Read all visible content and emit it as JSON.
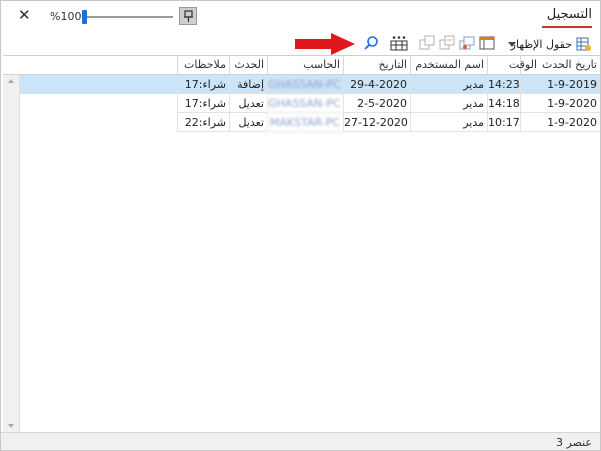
{
  "window": {
    "title": "التسجيل",
    "close_glyph": "✕"
  },
  "zoom": {
    "label": "%100",
    "level_percent": 100
  },
  "toolbar": {
    "fields_label": "حقول الإظهار",
    "icons": [
      "fields-icon",
      "dropdown-icon",
      "layout-icon",
      "export-icon",
      "collapse-icon",
      "expand-icon",
      "columns-icon",
      "search-icon",
      "pin-icon"
    ],
    "accent_color": "#e0181c"
  },
  "grid": {
    "columns": [
      "تاريخ الحدث",
      "الوقت",
      "اسم المستخدم",
      "التاريخ",
      "الحاسب",
      "الحدث",
      "ملاحظات"
    ],
    "rows": [
      {
        "event_date": "1-9-2019",
        "time": "14:23:46",
        "user": "مدير",
        "date": "29-4-2020",
        "computer": "GHASSAN-PC",
        "event": "إضافة",
        "notes": "شراء:17",
        "selected": true
      },
      {
        "event_date": "1-9-2020",
        "time": "14:18:18",
        "user": "مدير",
        "date": "2-5-2020",
        "computer": "GHASSAN-PC",
        "event": "تعديل",
        "notes": "شراء:17",
        "selected": false
      },
      {
        "event_date": "1-9-2020",
        "time": "10:17:07",
        "user": "مدير",
        "date": "27-12-2020",
        "computer": "MAKSTAR-PC",
        "event": "تعديل",
        "notes": "شراء:22",
        "selected": false
      }
    ]
  },
  "status": {
    "count_label": "3 عنصر"
  }
}
